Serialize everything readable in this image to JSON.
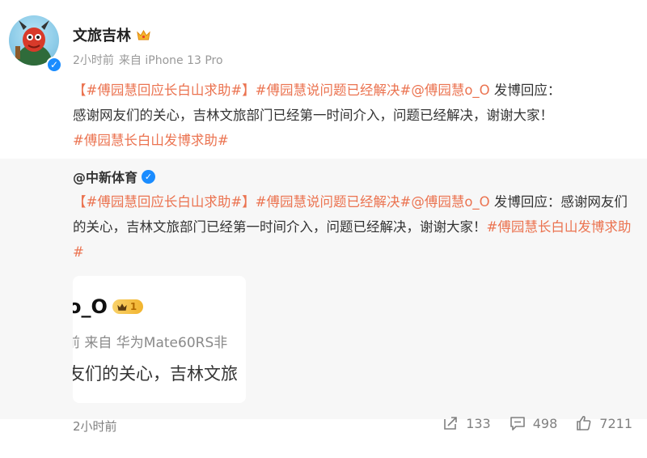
{
  "post": {
    "author": "文旅吉林",
    "time": "2小时前",
    "source": "来自 iPhone 13 Pro",
    "text": {
      "tag1": "【#傅园慧回应长白山求助#】",
      "tag2": "#傅园慧说问题已经解决#",
      "mention": "@傅园慧o_O",
      "body1": " 发博回应：",
      "body2": "感谢网友们的关心，吉林文旅部门已经第一时间介入，问题已经解决，谢谢大家！",
      "tag3": "#傅园慧长白山发博求助#"
    }
  },
  "repost": {
    "author": "@中新体育",
    "text": {
      "tag1": "【#傅园慧回应长白山求助#】",
      "tag2": "#傅园慧说问题已经解决#",
      "mention": "@傅园慧o_O",
      "body": " 发博回应：感谢网友们的关心，吉林文旅部门已经第一时间介入，问题已经解决，谢谢大家！",
      "tag3": "#傅园慧长白山发博求助#"
    },
    "thumbnail": {
      "line1": "o_O",
      "badge": "1",
      "line2": "前  来自  华为Mate60RS非",
      "line3": "友们的关心，吉林文旅"
    }
  },
  "footer": {
    "time": "2小时前",
    "repost_count": "133",
    "comment_count": "498",
    "like_count": "7211"
  },
  "colors": {
    "link": "#eb7350",
    "verified": "#1a8cff"
  }
}
